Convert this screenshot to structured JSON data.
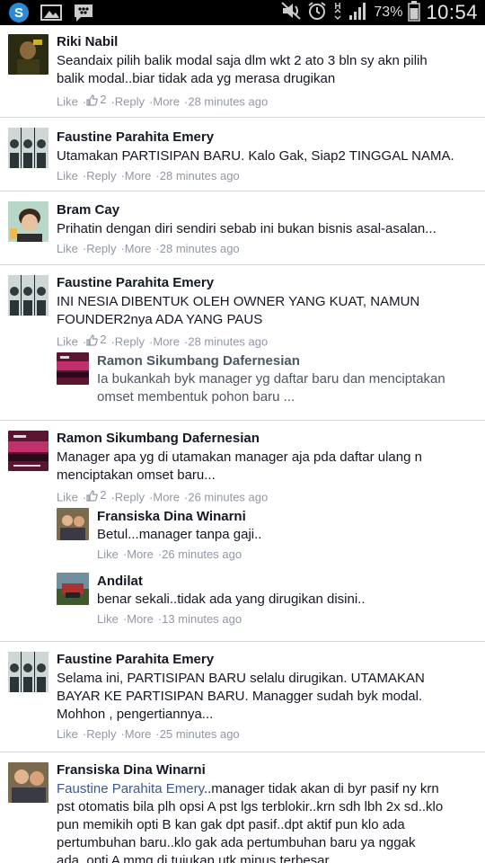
{
  "status_bar": {
    "battery_pct": "73%",
    "time": "10:54"
  },
  "comments": [
    {
      "author": "Riki Nabil",
      "text": "Seandaix pilih balik modal saja dlm wkt 2 ato 3 bln sy akn pilih\nbalik modal..biar tidak ada yg merasa drugikan",
      "like": "Like",
      "likes": "2",
      "reply": "Reply",
      "more": "More",
      "time": "28 minutes ago"
    },
    {
      "author": "Faustine Parahita Emery",
      "text": "Utamakan PARTISIPAN BARU. Kalo Gak, Siap2 TINGGAL NAMA.",
      "like": "Like",
      "reply": "Reply",
      "more": "More",
      "time": "28 minutes ago"
    },
    {
      "author": "Bram Cay",
      "text": "Prihatin dengan diri sendiri sebab ini bukan bisnis asal-asalan...",
      "like": "Like",
      "reply": "Reply",
      "more": "More",
      "time": "28 minutes ago"
    },
    {
      "author": "Faustine Parahita Emery",
      "text": "INI NESIA DIBENTUK OLEH OWNER YANG KUAT, NAMUN\nFOUNDER2nya ADA YANG PAUS",
      "like": "Like",
      "likes": "2",
      "reply": "Reply",
      "more": "More",
      "time": "28 minutes ago",
      "replies": [
        {
          "author": "Ramon Sikumbang Dafernesian",
          "text": "Ia bukankah byk manager yg daftar baru dan menciptakan\nomset membentuk pohon baru ..."
        }
      ]
    },
    {
      "author": "Ramon Sikumbang Dafernesian",
      "text": "Manager apa yg di utamakan manager aja pda daftar ulang n\nmenciptakan omset baru...",
      "like": "Like",
      "likes": "2",
      "reply": "Reply",
      "more": "More",
      "time": "26 minutes ago",
      "replies": [
        {
          "author": "Fransiska Dina Winarni",
          "text": "Betul...manager tanpa gaji..",
          "like": "Like",
          "more": "More",
          "time": "26 minutes ago"
        },
        {
          "author": "Andilat",
          "text": "benar sekali..tidak ada yang dirugikan disini..",
          "like": "Like",
          "more": "More",
          "time": "13 minutes ago"
        }
      ]
    },
    {
      "author": "Faustine Parahita Emery",
      "text": "Selama ini, PARTISIPAN BARU selalu dirugikan. UTAMAKAN\nBAYAR KE PARTISIPAN BARU. Managger sudah byk modal.\nMohhon , pengertiannya...",
      "like": "Like",
      "reply": "Reply",
      "more": "More",
      "time": "25 minutes ago"
    },
    {
      "author": "Fransiska Dina Winarni",
      "mention": "Faustine Parahita Emery",
      "text": "..manager tidak akan di byr pasif ny krn\npst otomatis bila plh opsi A pst lgs terblokir..krn sdh lbh 2x sd..klo\npun memikih opti B kan gak dpt pasif..dpt aktif pun klo ada\npertumbuhan baru..klo gak ada pertumbuhan baru ya nggak\nada..opti A mmg di tujukan utk minus terbesar"
    }
  ]
}
